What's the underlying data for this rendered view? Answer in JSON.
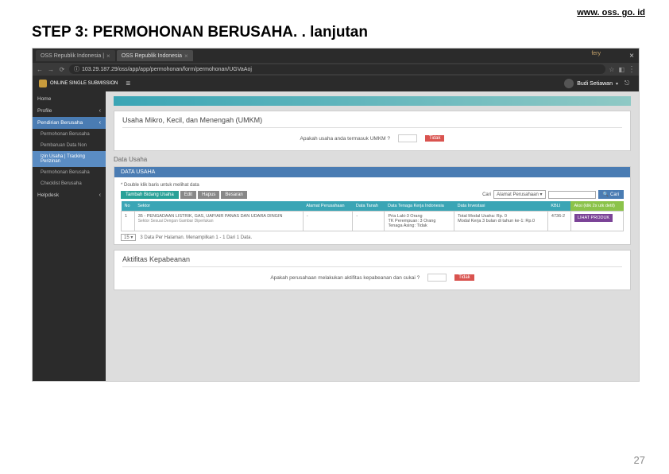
{
  "header_link": "www. oss. go. id",
  "step_title": "STEP 3: PERMOHONAN BERUSAHA. . lanjutan",
  "page_number": "27",
  "browser": {
    "tabs": [
      {
        "label": "OSS Republik Indonesia |",
        "active": false
      },
      {
        "label": "OSS Republik Indonesia",
        "active": true
      }
    ],
    "tail_label": "fery",
    "address": "103.29.187.29/oss/app/app/permohonan/form/permohonan/UGVaAoj",
    "app_name": "ONLINE SINGLE SUBMISSION",
    "user_name": "Budi Setiawan"
  },
  "sidebar": {
    "items": [
      {
        "label": "Home",
        "type": "main"
      },
      {
        "label": "Profile",
        "type": "main",
        "chev": true
      },
      {
        "label": "Pendirian Berusaha",
        "type": "blue",
        "chev": true
      },
      {
        "label": "Permohonan Berusaha",
        "type": "sub"
      },
      {
        "label": "Pembaruan Data Non",
        "type": "sub"
      },
      {
        "label": "Izin Usaha | Tracking Perizinan",
        "type": "sub-blue"
      },
      {
        "label": "Permohonan Berusaha",
        "type": "sub"
      },
      {
        "label": "Checklist Berusaha",
        "type": "sub"
      },
      {
        "label": "Helpdesk",
        "type": "main",
        "chev": true
      }
    ]
  },
  "content": {
    "umkm": {
      "title": "Usaha Mikro, Kecil, dan Menengah (UMKM)",
      "question": "Apakah usaha anda termasuk UMKM ?",
      "answer": "Tidak"
    },
    "data_usaha": {
      "section_label": "Data Usaha",
      "bar_title": "DATA USAHA",
      "note": "* Double klik baris untuk melihat data",
      "buttons": {
        "add": "Tambah Bidang Usaha",
        "edit": "Edit",
        "delete": "Hapus",
        "besaran": "Besaran"
      },
      "search": {
        "label": "Cari",
        "selected": "Alamat Perusahaan",
        "btn": "Cari"
      },
      "table": {
        "headers": [
          "No",
          "Sektor",
          "Alamat Perusahaan",
          "Data Tanah",
          "Data Tenaga Kerja Indonesia",
          "Data Investasi",
          "KBLI",
          "Aksi (klik 2x utk detil)"
        ],
        "row": {
          "no": "1",
          "sektor": "35 - PENGADAAN LISTRIK, GAS, UAP/AIR PANAS DAN UDARA DINGIN",
          "sektor_sub": "Sektor Sesuai Dengan Gambar Diperlukan",
          "alamat": "-",
          "tanah": "-",
          "tenaga": "Pria Laki-3 Orang\nTK Perempuan: 3 Orang\nTenaga Asing: Tidak",
          "investasi": "Total Modal Usaha: Rp. 0\nModal Kerja 3 bulan di tahun ke-1: Rp.0",
          "kbli": "4736-2",
          "aksi": "LIHAT PRODUK"
        }
      },
      "pager": {
        "size": "15",
        "info": "3 Data Per Halaman. Menampilkan 1 - 1 Dari 1 Data."
      }
    },
    "kepabeanan": {
      "title": "Aktifitas Kepabeanan",
      "question": "Apakah perusahaan melakukan aktifitas kepabeanan dan cukai ?",
      "answer": "Tidak"
    }
  }
}
